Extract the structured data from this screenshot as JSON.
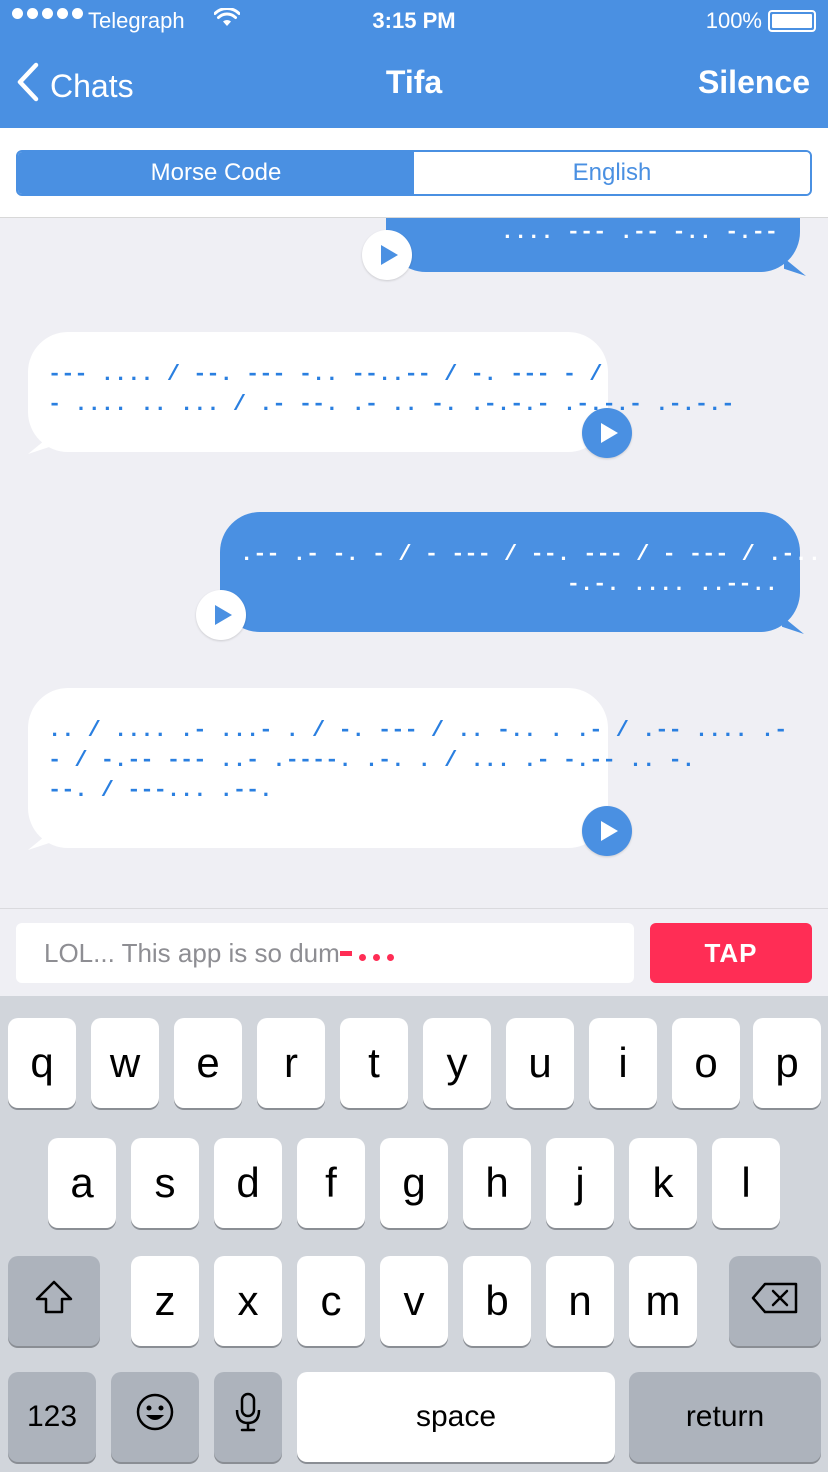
{
  "status_bar": {
    "carrier": "Telegraph",
    "time": "3:15 PM",
    "battery": "100%",
    "signal_icon": "signal-dots-icon",
    "wifi_icon": "wifi-icon"
  },
  "nav": {
    "back_label": "Chats",
    "title": "Tifa",
    "action_label": "Silence"
  },
  "segmented": {
    "options": [
      "Morse Code",
      "English"
    ],
    "selected": "Morse Code"
  },
  "messages": [
    {
      "direction": "outgoing",
      "lines": [
        ".... --- .-- -.. -.--"
      ]
    },
    {
      "direction": "incoming",
      "lines": [
        "--- .... / --. --- -.. --..-- / -. --- - /",
        "- .... .. ... / .- --. .- .. -. .-.-.- .-.-.- .-.-.-"
      ]
    },
    {
      "direction": "outgoing",
      "lines": [
        ".-- .- -. - / - --- / --. --- / - --- / .-.. ..- -.",
        "-.-. .... ..--.."
      ]
    },
    {
      "direction": "incoming",
      "lines": [
        ".. / .... .- ...- . / -. --- / .. -.. . .- / .-- .... .-",
        "- / -.-- --- ..- .----. .-. . / ... .- -.-- .. -.",
        "--. / ---... .--."
      ]
    }
  ],
  "input": {
    "value": "LOL...  This app is so dum"
  },
  "tap_button": "TAP",
  "keyboard": {
    "row1": [
      "q",
      "w",
      "e",
      "r",
      "t",
      "y",
      "u",
      "i",
      "o",
      "p"
    ],
    "row2": [
      "a",
      "s",
      "d",
      "f",
      "g",
      "h",
      "j",
      "k",
      "l"
    ],
    "row3": [
      "z",
      "x",
      "c",
      "v",
      "b",
      "n",
      "m"
    ],
    "numbers": "123",
    "space": "space",
    "return": "return",
    "shift_icon": "shift-icon",
    "delete_icon": "backspace-icon",
    "emoji_icon": "emoji-icon",
    "mic_icon": "microphone-icon"
  },
  "colors": {
    "brand_blue": "#4a90e2",
    "tap_red": "#ff2d55"
  }
}
